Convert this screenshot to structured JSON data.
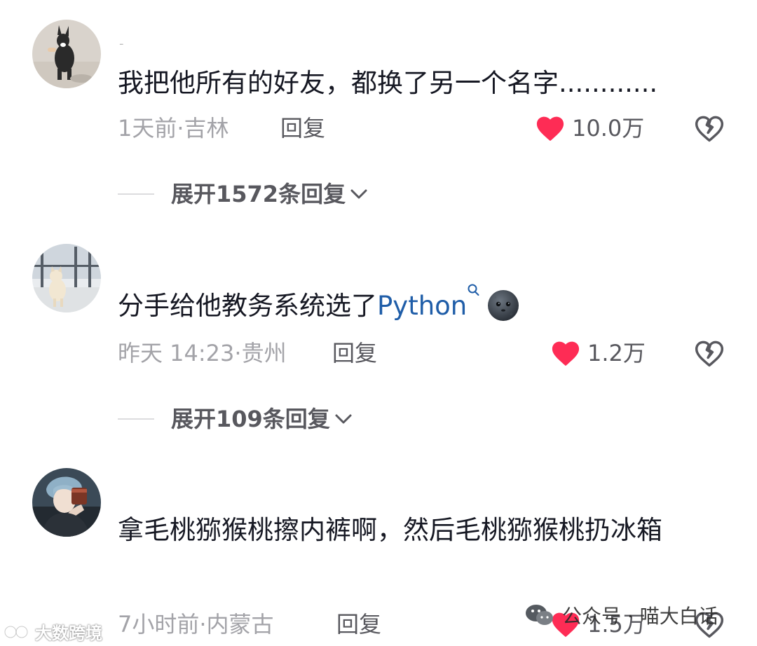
{
  "comments": [
    {
      "author_mark": "-",
      "text": "我把他所有的好友，都换了另一个名字............",
      "time_location": "1天前·吉林",
      "reply_label": "回复",
      "like_count": "10.0万",
      "expand_label": "展开1572条回复"
    },
    {
      "text": "分手给他教务系统选了",
      "keyword": "Python",
      "time_location": "昨天 14:23·贵州",
      "reply_label": "回复",
      "like_count": "1.2万",
      "expand_label": "展开109条回复"
    },
    {
      "text": "拿毛桃猕猴桃擦内裤啊，然后毛桃猕猴桃扔冰箱",
      "time_location": "7小时前·内蒙古",
      "reply_label": "回复",
      "like_count": "1.5万"
    }
  ],
  "watermarks": {
    "left": "大数跨境",
    "right": "公众号 · 喵大白话"
  },
  "colors": {
    "like_red": "#fe2c55",
    "keyword_blue": "#1f5da8",
    "meta_gray": "#a3a3a8"
  },
  "icons": [
    "heart-icon",
    "broken-heart-icon",
    "search-icon",
    "chevron-down-icon",
    "moon-face-emoji",
    "wechat-icon"
  ]
}
